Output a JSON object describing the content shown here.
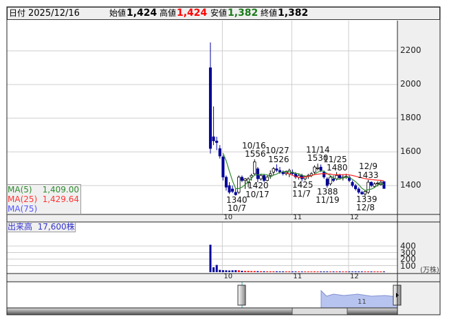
{
  "header": {
    "date_label": "日付",
    "date": "2025/12/16",
    "open_label": "始値",
    "open": "1,424",
    "high_label": "高値",
    "high": "1,424",
    "low_label": "安値",
    "low": "1,382",
    "close_label": "終値",
    "close": "1,382"
  },
  "ma_legend": {
    "ma5_label": "MA(5)",
    "ma5": "1,409.00",
    "ma25_label": "MA(25)",
    "ma25": "1,429.64",
    "ma75_label": "MA(75)"
  },
  "volume_legend": {
    "label": "出来高",
    "value": "17,600株"
  },
  "volume_unit": "(万株)",
  "navigator": {
    "month_label": "11"
  },
  "colors": {
    "down": "#000099",
    "up": "#ffffff",
    "ma5": "#2e8b2e",
    "ma25": "#ff2020",
    "vol_up": "#ff0000",
    "vol_down": "#000099"
  },
  "chart_data": {
    "type": "candlestick",
    "price_ticks": [
      "2200",
      "2000",
      "1800",
      "1600",
      "1400"
    ],
    "price_tick_values": [
      2200,
      2000,
      1800,
      1600,
      1400
    ],
    "volume_ticks": [
      "400",
      "300",
      "200",
      "100"
    ],
    "volume_tick_values": [
      400,
      300,
      200,
      100
    ],
    "month_labels": [
      {
        "label": "10",
        "index": 4
      },
      {
        "label": "11",
        "index": 26
      },
      {
        "label": "12",
        "index": 44
      }
    ],
    "ohlc": [
      [
        2100,
        2250,
        1590,
        1620
      ],
      [
        1690,
        1870,
        1640,
        1665
      ],
      [
        1665,
        1690,
        1610,
        1655
      ],
      [
        1620,
        1640,
        1560,
        1575
      ],
      [
        1570,
        1580,
        1430,
        1450
      ],
      [
        1450,
        1460,
        1370,
        1390
      ],
      [
        1400,
        1420,
        1350,
        1360
      ],
      [
        1380,
        1400,
        1355,
        1365
      ],
      [
        1360,
        1380,
        1340,
        1345
      ],
      [
        1360,
        1460,
        1350,
        1450
      ],
      [
        1450,
        1460,
        1420,
        1430
      ],
      [
        1430,
        1445,
        1380,
        1440
      ],
      [
        1420,
        1450,
        1390,
        1440
      ],
      [
        1450,
        1470,
        1430,
        1460
      ],
      [
        1470,
        1556,
        1460,
        1540
      ],
      [
        1500,
        1510,
        1420,
        1440
      ],
      [
        1440,
        1470,
        1430,
        1460
      ],
      [
        1460,
        1470,
        1420,
        1430
      ],
      [
        1430,
        1460,
        1425,
        1450
      ],
      [
        1460,
        1490,
        1440,
        1470
      ],
      [
        1480,
        1510,
        1460,
        1500
      ],
      [
        1500,
        1526,
        1480,
        1490
      ],
      [
        1490,
        1510,
        1470,
        1480
      ],
      [
        1480,
        1490,
        1460,
        1470
      ],
      [
        1470,
        1490,
        1460,
        1480
      ],
      [
        1470,
        1500,
        1450,
        1490
      ],
      [
        1480,
        1495,
        1460,
        1470
      ],
      [
        1470,
        1480,
        1440,
        1450
      ],
      [
        1450,
        1470,
        1435,
        1460
      ],
      [
        1460,
        1470,
        1425,
        1440
      ],
      [
        1440,
        1460,
        1430,
        1455
      ],
      [
        1455,
        1470,
        1440,
        1460
      ],
      [
        1460,
        1480,
        1450,
        1470
      ],
      [
        1480,
        1520,
        1470,
        1510
      ],
      [
        1500,
        1530,
        1490,
        1505
      ],
      [
        1510,
        1525,
        1480,
        1490
      ],
      [
        1480,
        1490,
        1440,
        1450
      ],
      [
        1440,
        1450,
        1388,
        1400
      ],
      [
        1410,
        1460,
        1400,
        1450
      ],
      [
        1440,
        1460,
        1420,
        1430
      ],
      [
        1440,
        1480,
        1430,
        1460
      ],
      [
        1460,
        1470,
        1440,
        1445
      ],
      [
        1445,
        1465,
        1430,
        1450
      ],
      [
        1450,
        1470,
        1440,
        1455
      ],
      [
        1450,
        1460,
        1420,
        1430
      ],
      [
        1420,
        1430,
        1390,
        1400
      ],
      [
        1400,
        1410,
        1370,
        1380
      ],
      [
        1380,
        1390,
        1350,
        1360
      ],
      [
        1360,
        1370,
        1345,
        1350
      ],
      [
        1350,
        1370,
        1339,
        1365
      ],
      [
        1360,
        1433,
        1350,
        1420
      ],
      [
        1420,
        1425,
        1390,
        1400
      ],
      [
        1395,
        1420,
        1385,
        1410
      ],
      [
        1410,
        1425,
        1395,
        1415
      ],
      [
        1405,
        1430,
        1400,
        1420
      ],
      [
        1424,
        1424,
        1382,
        1382
      ]
    ],
    "volume": [
      420,
      75,
      110,
      35,
      30,
      28,
      25,
      28,
      30,
      28,
      20,
      18,
      18,
      16,
      16,
      15,
      14,
      13,
      12,
      12,
      12,
      12,
      11,
      11,
      11,
      11,
      11,
      10,
      10,
      10,
      10,
      10,
      10,
      11,
      10,
      10,
      10,
      10,
      10,
      10,
      10,
      10,
      10,
      10,
      10,
      10,
      10,
      10,
      10,
      10,
      10,
      10,
      10,
      10,
      10,
      10
    ],
    "annotations": [
      {
        "text": "10/16",
        "pos": "a1"
      },
      {
        "text": "1556",
        "pos": "a2"
      },
      {
        "text": "10/27",
        "pos": "a3"
      },
      {
        "text": "1526",
        "pos": "a4"
      },
      {
        "text": "11/14",
        "pos": "a5"
      },
      {
        "text": "1530",
        "pos": "a6"
      },
      {
        "text": "11/25",
        "pos": "a7"
      },
      {
        "text": "1480",
        "pos": "a8"
      },
      {
        "text": "12/9",
        "pos": "a9"
      },
      {
        "text": "1433",
        "pos": "a10"
      },
      {
        "text": "1420",
        "pos": "b1"
      },
      {
        "text": "10/17",
        "pos": "b2"
      },
      {
        "text": "1340",
        "pos": "b3"
      },
      {
        "text": "10/7",
        "pos": "b4"
      },
      {
        "text": "1425",
        "pos": "b5"
      },
      {
        "text": "11/7",
        "pos": "b6"
      },
      {
        "text": "1388",
        "pos": "b7"
      },
      {
        "text": "11/19",
        "pos": "b8"
      },
      {
        "text": "1339",
        "pos": "b9"
      },
      {
        "text": "12/8",
        "pos": "b10"
      }
    ]
  }
}
